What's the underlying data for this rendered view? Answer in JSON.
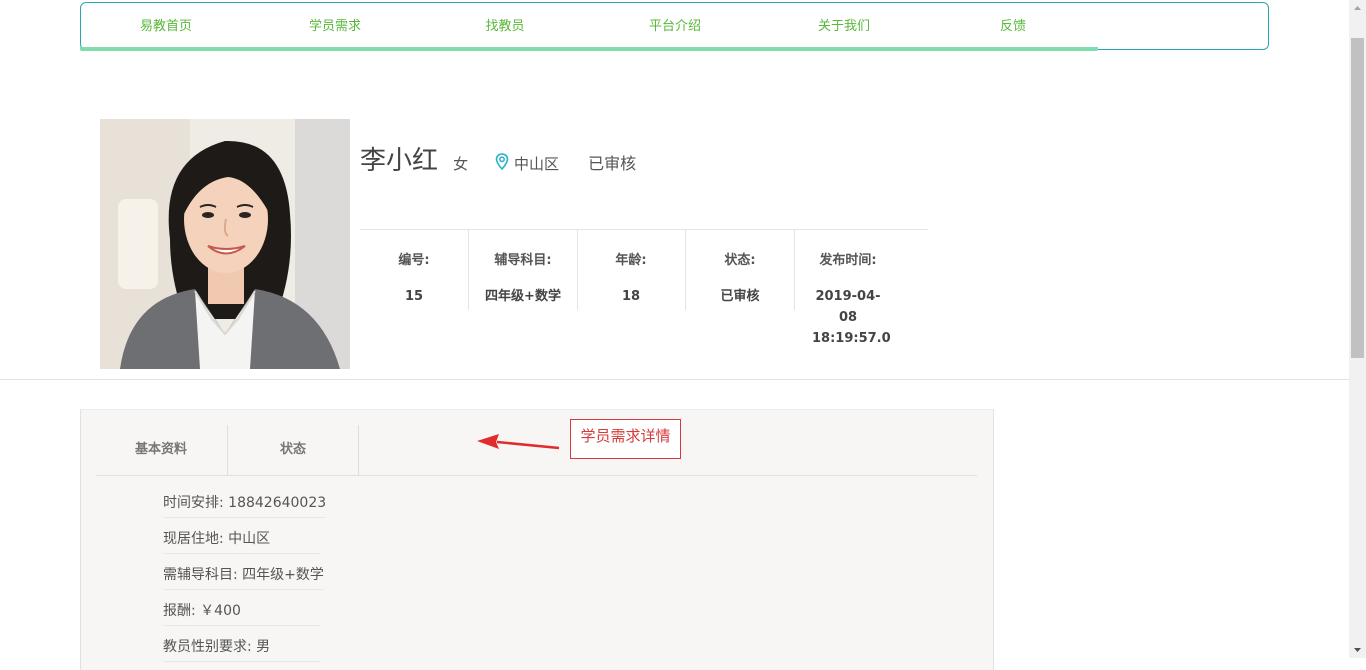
{
  "nav": {
    "items": [
      "易教首页",
      "学员需求",
      "找教员",
      "平台介绍",
      "关于我们",
      "反馈"
    ]
  },
  "profile": {
    "name": "李小红",
    "gender": "女",
    "location": "中山区",
    "status": "已审核",
    "info": [
      {
        "label": "编号:",
        "value": "15"
      },
      {
        "label": "辅导科目:",
        "value": "四年级+数学"
      },
      {
        "label": "年龄:",
        "value": "18"
      },
      {
        "label": "状态:",
        "value": "已审核"
      },
      {
        "label": "发布时间:",
        "value": "2019-04-08 18:19:57.0"
      }
    ]
  },
  "details": {
    "tabs": [
      "基本资料",
      "状态"
    ],
    "fields": [
      "时间安排: 18842640023",
      "现居住地: 中山区",
      "需辅导科目: 四年级+数学",
      "报酬: ￥400",
      "教员性别要求: 男"
    ]
  },
  "annotation": {
    "text": "学员需求详情",
    "color": "#d63a3a"
  },
  "colors": {
    "nav_text": "#58b83a",
    "nav_border": "#2aa6b3",
    "nav_underline": "#7fdcab",
    "location_icon": "#27b3c3"
  },
  "icons": {
    "location": "location-pin-icon"
  }
}
